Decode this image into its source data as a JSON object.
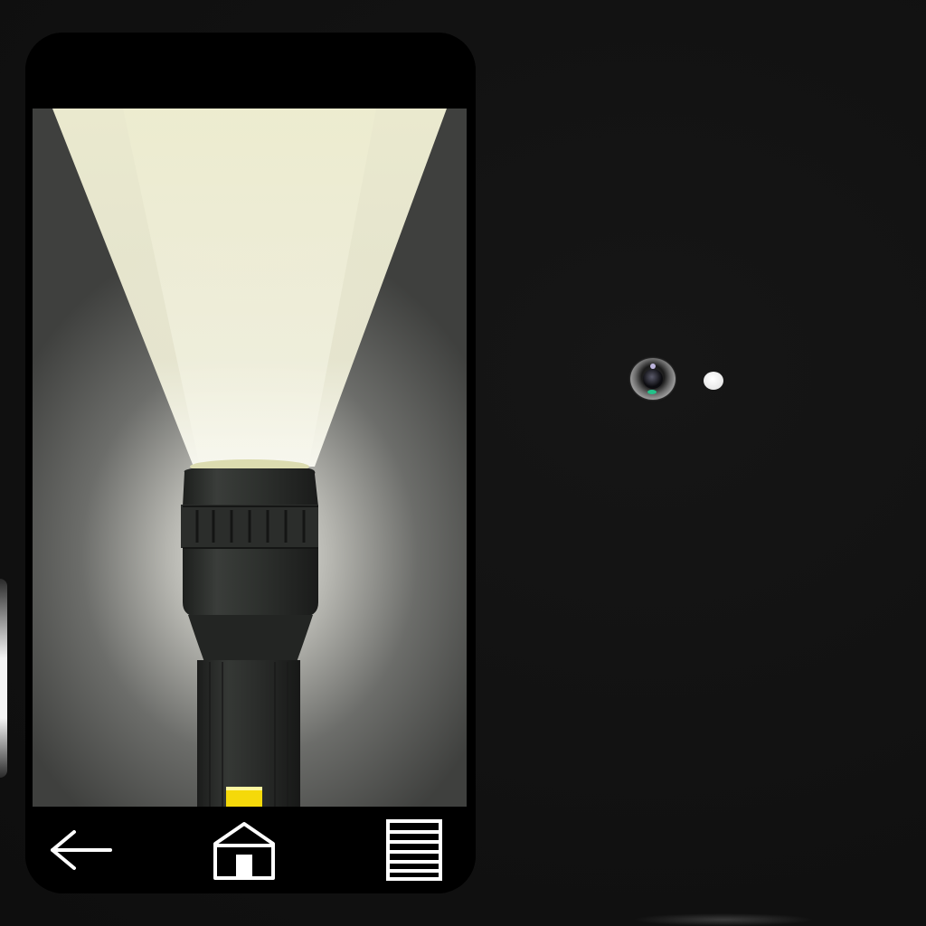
{
  "device": {
    "screen_app": "flashlight",
    "flashlight_state": "on",
    "beam_color": "#f3f2d6",
    "indicator_color": "#f5d90a"
  },
  "navigation": {
    "back_icon": "back-arrow-icon",
    "home_icon": "home-icon",
    "menu_icon": "menu-list-icon"
  },
  "hardware": {
    "camera_icon": "camera-lens-icon",
    "flash_icon": "flash-led-icon",
    "flash_color": "#ffffff",
    "camera_led_color": "#23c28a"
  }
}
